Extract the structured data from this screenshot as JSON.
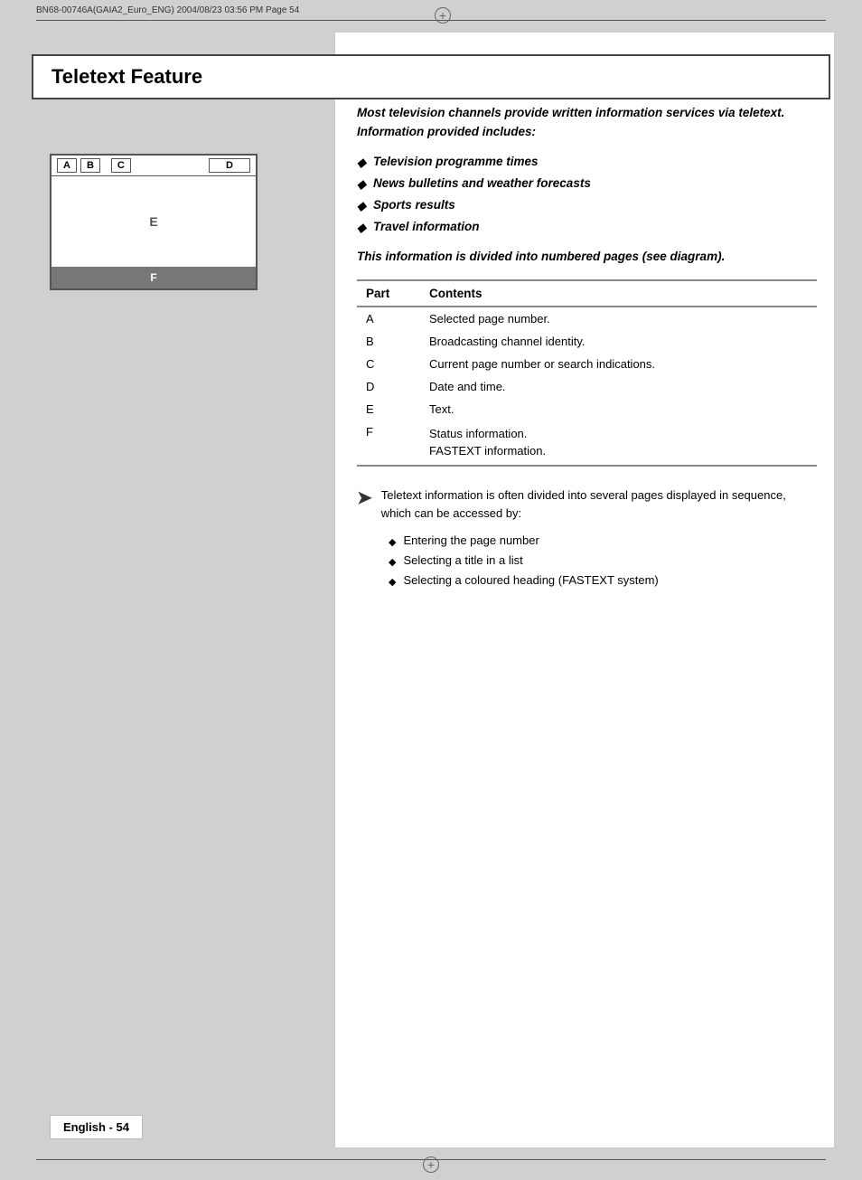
{
  "header": {
    "file_info": "BN68-00746A(GAIA2_Euro_ENG)    2004/08/23    03:56 PM    Page 54"
  },
  "title": "Teletext Feature",
  "intro": {
    "text": "Most television channels provide written information services via teletext. Information provided includes:"
  },
  "bullets": [
    {
      "text": "Television programme times"
    },
    {
      "text": "News bulletins and weather forecasts"
    },
    {
      "text": "Sports results"
    },
    {
      "text": "Travel information"
    }
  ],
  "diagram_note": "This information is divided into numbered pages (see diagram).",
  "diagram": {
    "parts": [
      "A",
      "B",
      "C",
      "D"
    ],
    "middle_label": "E",
    "bottom_label": "F"
  },
  "table": {
    "col1": "Part",
    "col2": "Contents",
    "rows": [
      {
        "part": "A",
        "content": "Selected page number."
      },
      {
        "part": "B",
        "content": "Broadcasting channel identity."
      },
      {
        "part": "C",
        "content": "Current page number or search indications."
      },
      {
        "part": "D",
        "content": "Date and time."
      },
      {
        "part": "E",
        "content": "Text."
      },
      {
        "part": "F",
        "content": "Status information.\nFASTEXT information."
      }
    ]
  },
  "note": {
    "text": "Teletext information is often divided into several pages displayed in sequence, which can be accessed by:"
  },
  "note_bullets": [
    {
      "text": "Entering the page number"
    },
    {
      "text": "Selecting a title in a list"
    },
    {
      "text": "Selecting a coloured heading (FASTEXT system)"
    }
  ],
  "footer": {
    "label": "English - 54"
  }
}
